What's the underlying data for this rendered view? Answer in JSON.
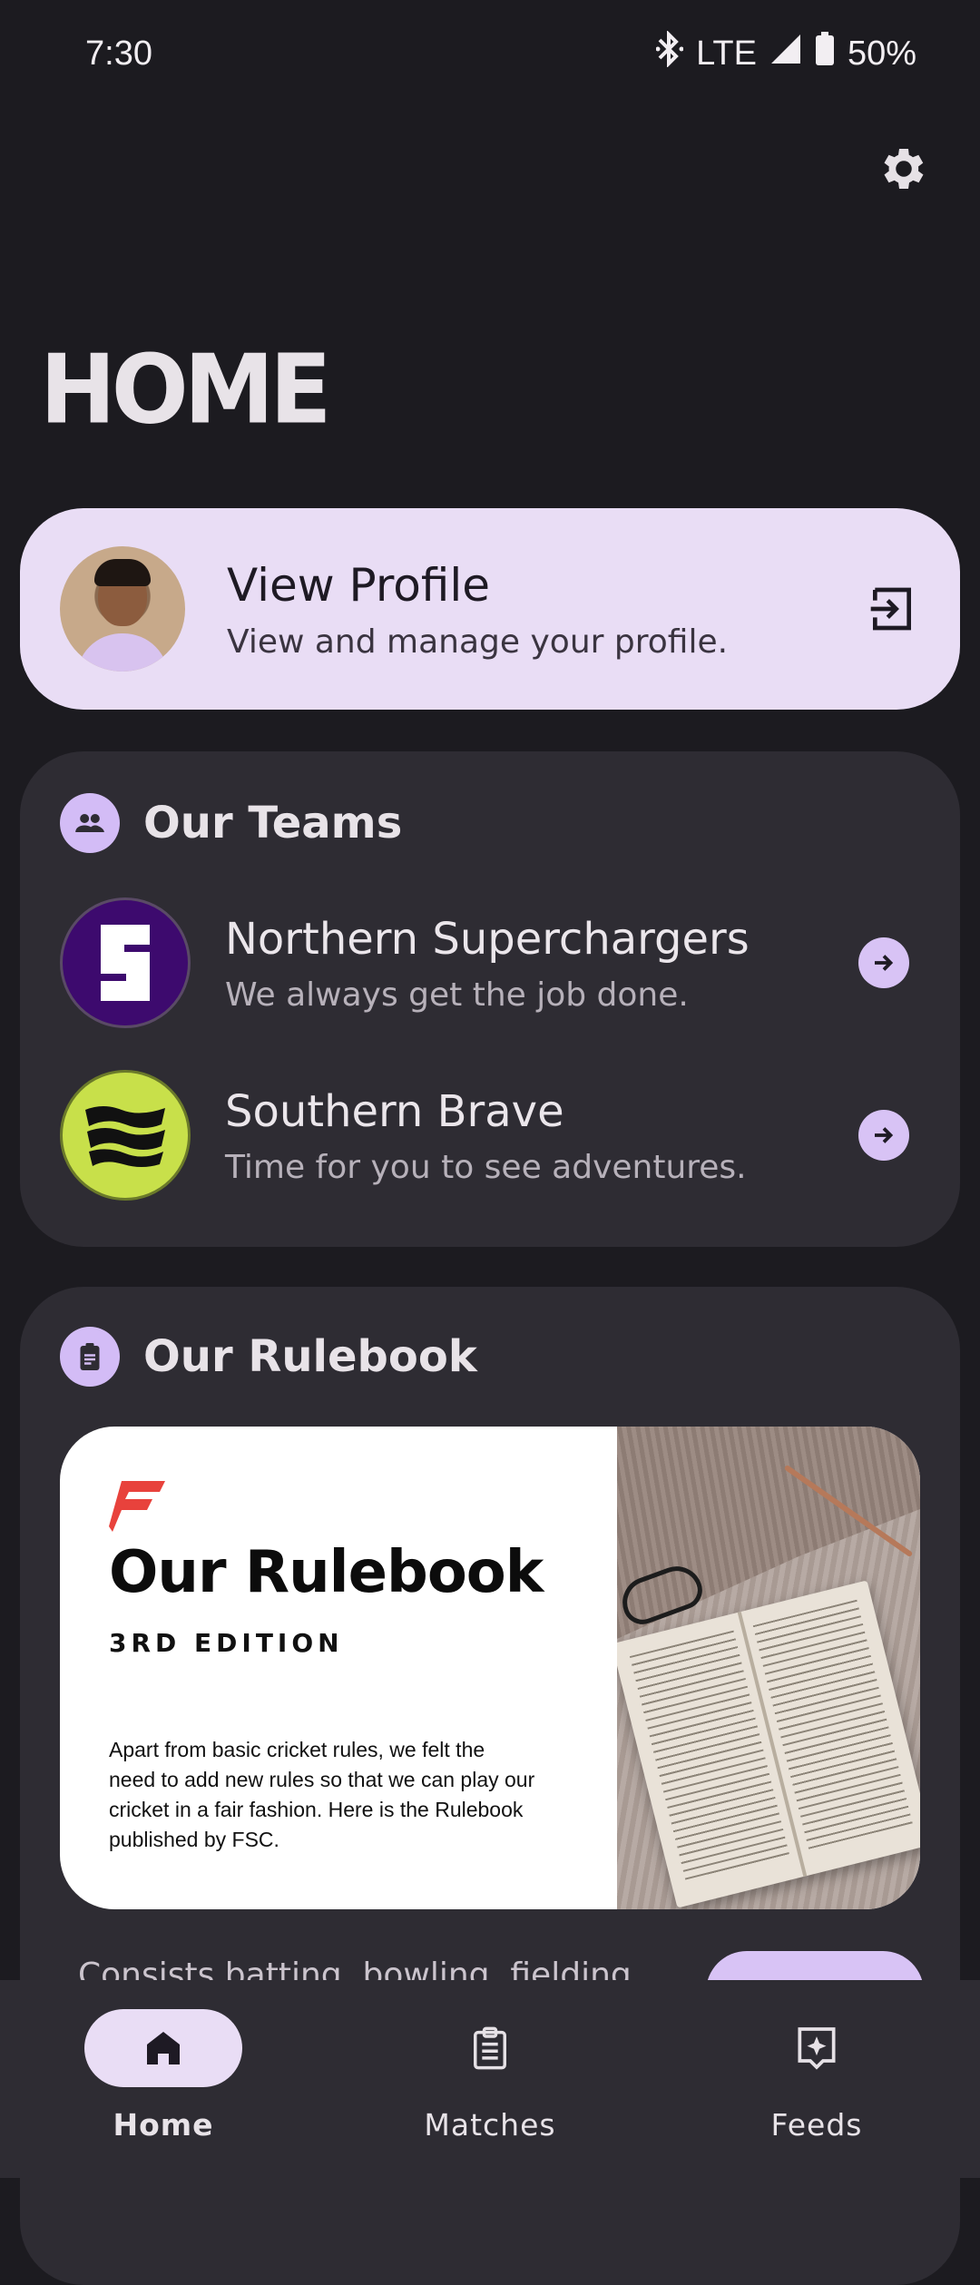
{
  "status_bar": {
    "time": "7:30",
    "network": "LTE",
    "battery": "50%",
    "icons": [
      "bluetooth-icon",
      "signal-icon",
      "battery-icon"
    ]
  },
  "header": {
    "title": "HOME",
    "settings_icon": "gear-icon"
  },
  "profile": {
    "title": "View Profile",
    "subtitle": "View and manage your profile.",
    "action_icon": "login-icon"
  },
  "teams": {
    "title": "Our Teams",
    "icon": "group-icon",
    "items": [
      {
        "name": "Northern Superchargers",
        "motto": "We always get the job done.",
        "color": "#3d0a6e"
      },
      {
        "name": "Southern Brave",
        "motto": "Time for you to see adventures.",
        "color": "#c8e04a"
      }
    ]
  },
  "rulebook": {
    "title": "Our Rulebook",
    "icon": "clipboard-icon",
    "banner": {
      "title": "Our Rulebook",
      "edition": "3RD EDITION",
      "description": "Apart from basic cricket rules, we felt the need to add new rules so that we can play our cricket in a fair fashion. Here is the Rulebook published by FSC."
    },
    "footer_text": "Consists batting, bowling, fielding"
  },
  "bottom_nav": {
    "items": [
      {
        "label": "Home",
        "icon": "home-icon",
        "active": true
      },
      {
        "label": "Matches",
        "icon": "clipboard-list-icon",
        "active": false
      },
      {
        "label": "Feeds",
        "icon": "feed-star-icon",
        "active": false
      }
    ]
  },
  "colors": {
    "background": "#1c1b20",
    "card": "#2e2c33",
    "accent": "#d8c3f5",
    "profile_card": "#e9ddf5"
  }
}
